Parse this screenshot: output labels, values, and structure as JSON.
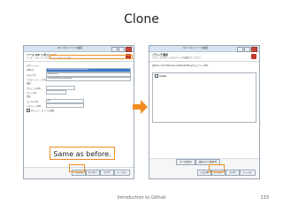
{
  "slide": {
    "title": "Clone",
    "footer": "Introduction to Github",
    "page_number": "133",
    "callout": "Same as before."
  },
  "left_window": {
    "title": "Git リポジトリーの複製",
    "header": "ソース Git リポジトリー",
    "subheader": "ソース・リポジトリーのロケーションを入力します。",
    "location_label": "ロケーション",
    "uri_label": "URI(U):",
    "uri_value": "https://github.com/hotta/sosuoz/Pocket4Ho.git",
    "host_label": "ホスト(T):",
    "host_value": "github.com",
    "repo_path_label": "リポジトリー・パス(P):",
    "repo_path_value": "/hotta/sosuoz/Pocket4Ho.git",
    "connection_label": "接続",
    "protocol_label": "プロトコル(R):",
    "port_label": "ポート(O):",
    "auth_label": "認証",
    "user_label": "ユーザー(E):",
    "user_value": "git",
    "password_label": "パスワード(W):",
    "store_label": "セキュア・ストアに保管",
    "buttons": {
      "back": "< 戻る(B)",
      "next": "次へ(N) >",
      "finish": "完了(F)",
      "cancel": "キャンセル"
    }
  },
  "right_window": {
    "title": "Git リポジトリーの複製",
    "header": "ブランチ選択",
    "subheader": "リモートからクローンするブランチを選択してください。",
    "branches_label": "github.com:hotta/sosuoz/Pocket4Ho.git のブランチ(B):",
    "branch_item": "master",
    "buttons": {
      "select_all": "すべて選択(S)",
      "deselect_all": "選択をすべて解除(D)",
      "back": "< 戻る(B)",
      "next": "次へ(N) >",
      "finish": "完了(F)",
      "cancel": "キャンセル"
    }
  },
  "colors": {
    "highlight": "#f28c1f",
    "selection": "#3a79c9",
    "titlebar": "#d6e4f2"
  }
}
